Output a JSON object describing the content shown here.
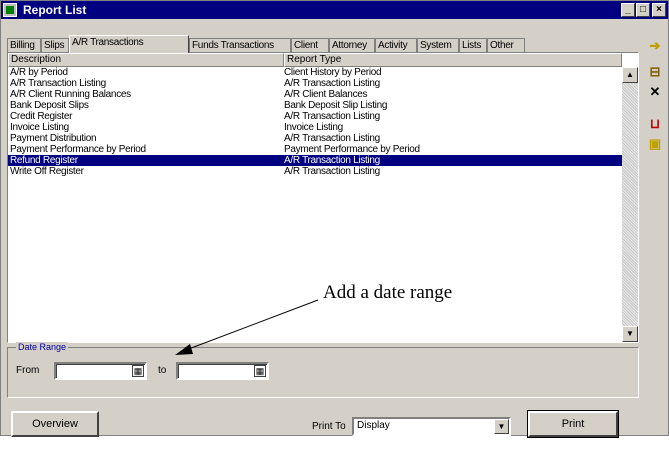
{
  "window": {
    "title": "Report List",
    "minimize": "_",
    "maximize": "□",
    "close": "×"
  },
  "tabs": [
    {
      "label": "Billing"
    },
    {
      "label": "Slips"
    },
    {
      "label": "A/R Transactions"
    },
    {
      "label": "Funds Transactions"
    },
    {
      "label": "Client"
    },
    {
      "label": "Attorney"
    },
    {
      "label": "Activity"
    },
    {
      "label": "System"
    },
    {
      "label": "Lists"
    },
    {
      "label": "Other"
    }
  ],
  "list": {
    "col_description": "Description",
    "col_type": "Report Type",
    "rows": [
      {
        "description": "A/R by Period",
        "type": "Client History by Period"
      },
      {
        "description": "A/R Transaction Listing",
        "type": "A/R Transaction Listing"
      },
      {
        "description": "A/R Client Running Balances",
        "type": "A/R Client Balances"
      },
      {
        "description": "Bank Deposit Slips",
        "type": "Bank Deposit Slip Listing"
      },
      {
        "description": "Credit Register",
        "type": "A/R Transaction Listing"
      },
      {
        "description": "Invoice Listing",
        "type": "Invoice Listing"
      },
      {
        "description": "Payment Distribution",
        "type": "A/R Transaction Listing"
      },
      {
        "description": "Payment Performance by Period",
        "type": "Payment Performance by Period"
      },
      {
        "description": "Refund Register",
        "type": "A/R Transaction Listing",
        "selected": true
      },
      {
        "description": "Write Off Register",
        "type": "A/R Transaction Listing"
      }
    ]
  },
  "date_range": {
    "legend": "Date Range",
    "from_label": "From",
    "to_label": "to",
    "from_value": "",
    "to_value": ""
  },
  "footer": {
    "overview_label": "Overview",
    "print_to_label": "Print To",
    "print_to_value": "Display",
    "print_label": "Print"
  },
  "annotation": {
    "text": "Add a date range"
  }
}
